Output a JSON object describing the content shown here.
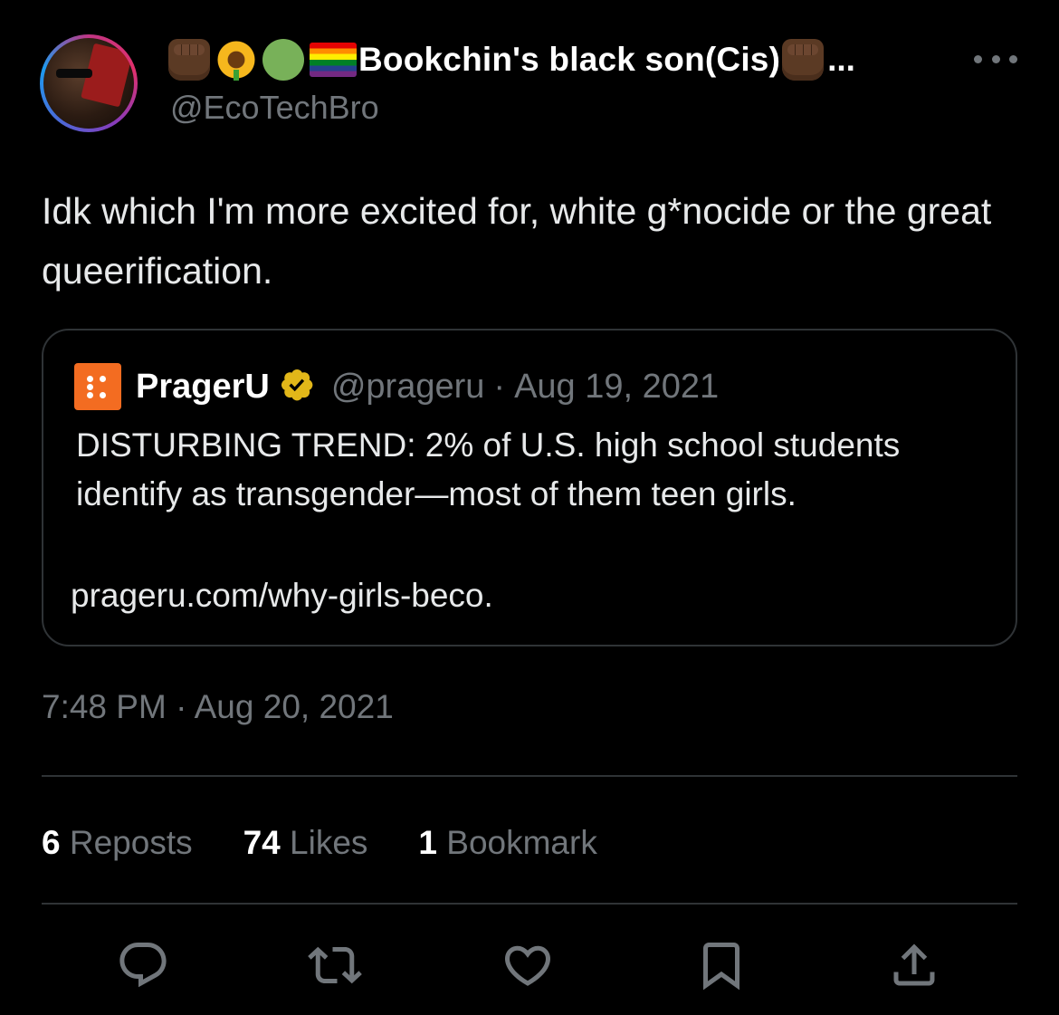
{
  "author": {
    "display_name": "Bookchin's black son(Cis)",
    "truncation": "...",
    "handle": "@EcoTechBro",
    "name_emojis": [
      "raised-fist-dark-skin-icon",
      "sunflower-icon",
      "green-circle-icon",
      "rainbow-flag-icon"
    ],
    "trailing_emoji": "raised-fist-dark-skin-icon"
  },
  "tweet": {
    "text": "Idk which I'm more excited for, white g*nocide or the great queerification."
  },
  "quote": {
    "name": "PragerU",
    "handle": "@prageru",
    "separator": "·",
    "date": "Aug 19, 2021",
    "text": "DISTURBING TREND: 2% of U.S. high school students identify as transgender—most of them teen girls.",
    "link": "prageru.com/why-girls-beco."
  },
  "timestamp": "7:48 PM · Aug 20, 2021",
  "stats": {
    "reposts_count": "6",
    "reposts_label": "Reposts",
    "likes_count": "74",
    "likes_label": "Likes",
    "bookmarks_count": "1",
    "bookmarks_label": "Bookmark"
  },
  "actions": [
    "reply-icon",
    "repost-icon",
    "like-icon",
    "bookmark-icon",
    "share-icon"
  ],
  "colors": {
    "background": "#000000",
    "text": "#e7e9ea",
    "secondary": "#71767b",
    "border": "#2f3336",
    "verified_gold": "#e2b719",
    "prageru_orange": "#f36c21"
  }
}
